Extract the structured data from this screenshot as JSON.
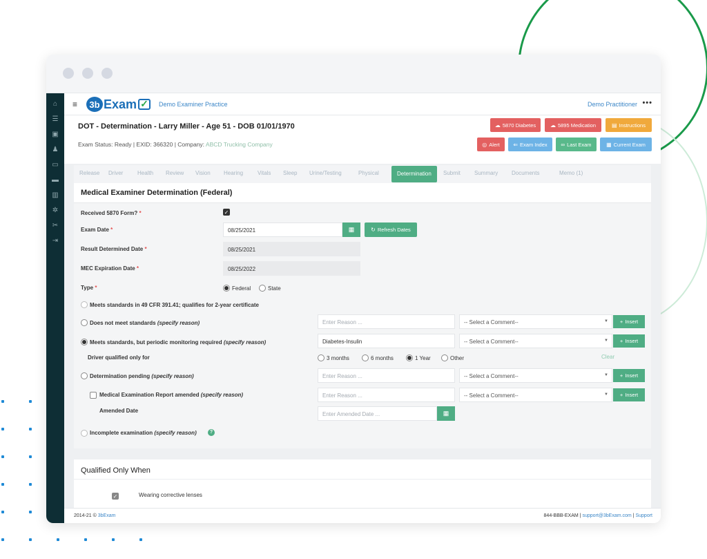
{
  "topbar": {
    "practice": "Demo Examiner Practice",
    "practitioner": "Demo Practitioner",
    "more": "•••",
    "logo_3b": "3b",
    "logo_exam": "Exam"
  },
  "header": {
    "title": "DOT - Determination - Larry Miller - Age 51 - DOB 01/01/1970",
    "status_prefix": "Exam Status: Ready | EXID: 366320 | Company: ",
    "company": "ABCD Trucking Company",
    "buttons": {
      "diabetes": "5870 Diabetes",
      "medication": "5895 Medication",
      "instructions": "Instructions",
      "alert": "Alert",
      "exam_index": "Exam Index",
      "last_exam": "Last Exam",
      "current_exam": "Current Exam"
    }
  },
  "tabs": [
    "Release",
    "Driver",
    "Health",
    "Review",
    "Vision",
    "Hearing",
    "Vitals",
    "Sleep",
    "Urine/Testing",
    "Physical",
    "Determination",
    "Submit",
    "Summary",
    "Documents",
    "Memo (1)"
  ],
  "active_tab": "Determination",
  "section": {
    "title": "Medical Examiner Determination (Federal)"
  },
  "form": {
    "received_5870": "Received 5870 Form?",
    "exam_date_label": "Exam Date",
    "exam_date_value": "08/25/2021",
    "refresh_dates": "Refresh Dates",
    "result_date_label": "Result Determined Date",
    "result_date_value": "08/25/2021",
    "mec_label": "MEC Expiration Date",
    "mec_value": "08/25/2022",
    "type_label": "Type",
    "type_federal": "Federal",
    "type_state": "State",
    "meets_standards": "Meets standards in 49 CFR 391.41; qualifies for 2-year certificate",
    "not_meet": "Does not meet standards",
    "not_meet_spec": "(specify reason)",
    "periodic": "Meets standards, but periodic monitoring required",
    "periodic_spec": "(specify reason)",
    "periodic_reason": "Diabetes-Insulin",
    "qualified_for": "Driver qualified only for",
    "q_3m": "3 months",
    "q_6m": "6 months",
    "q_1y": "1 Year",
    "q_other": "Other",
    "clear": "Clear",
    "pending": "Determination pending",
    "pending_spec": "(specify reason)",
    "amended": "Medical Examination Report amended",
    "amended_spec": "(specify reason)",
    "amended_date": "Amended Date",
    "amended_date_ph": "Enter Amended Date ...",
    "incomplete": "Incomplete examination",
    "incomplete_spec": "(specify reason)",
    "reason_ph": "Enter Reason ...",
    "comment_ph": "-- Select a Comment--",
    "insert": "Insert",
    "required": "*"
  },
  "qualified_card": {
    "title": "Qualified Only When",
    "item_1": "Wearing corrective lenses"
  },
  "footer": {
    "copy_prefix": "2014-21 © ",
    "copy_brand": "3bExam",
    "phone": "844-BBB-EXAM",
    "sep": " | ",
    "email": "support@3bExam.com",
    "support": "Support"
  },
  "colors": {
    "accent_green": "#4fad84",
    "sidebar": "#0e2e35",
    "red_button": "#e36060",
    "orange_button": "#f0a93c",
    "blue_button": "#6db3e6"
  }
}
